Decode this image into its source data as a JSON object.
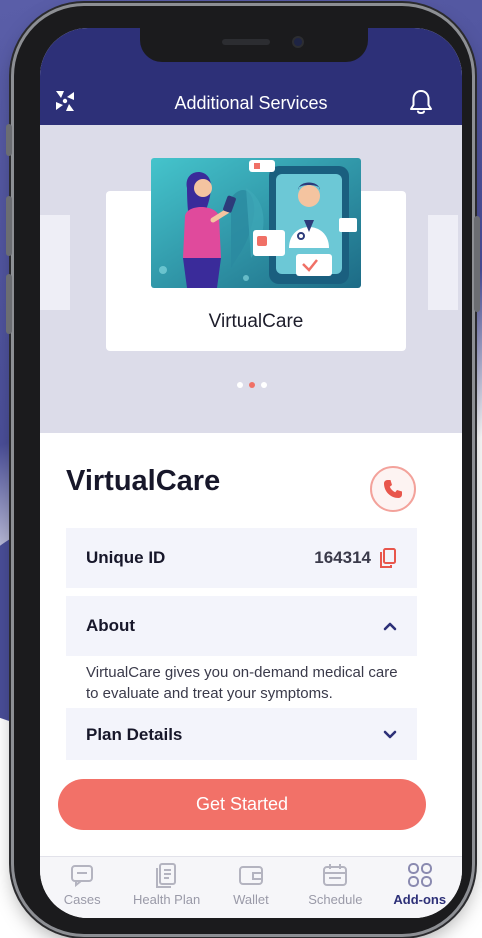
{
  "header": {
    "title": "Additional Services",
    "logo_icon": "spark-logo-icon",
    "bell_icon": "bell-icon"
  },
  "carousel": {
    "card_title": "VirtualCare",
    "slide_count": 3,
    "active_slide": 2
  },
  "service": {
    "title": "VirtualCare",
    "call_icon": "phone-icon",
    "unique_id_label": "Unique ID",
    "unique_id_value": "164314",
    "copy_icon": "copy-icon",
    "about_label": "About",
    "about_text": "VirtualCare gives you on-demand medical care to evaluate and treat your symptoms.",
    "plan_details_label": "Plan Details"
  },
  "cta": {
    "label": "Get Started"
  },
  "tabs": [
    {
      "label": "Cases",
      "icon": "chat-icon",
      "active": false
    },
    {
      "label": "Health Plan",
      "icon": "document-icon",
      "active": false
    },
    {
      "label": "Wallet",
      "icon": "wallet-icon",
      "active": false
    },
    {
      "label": "Schedule",
      "icon": "calendar-icon",
      "active": false
    },
    {
      "label": "Add-ons",
      "icon": "grid-icon",
      "active": true
    }
  ],
  "colors": {
    "header": "#2d3078",
    "accent": "#f27168",
    "carousel_bg": "#dcdce9",
    "row_bg": "#f3f4fb"
  }
}
